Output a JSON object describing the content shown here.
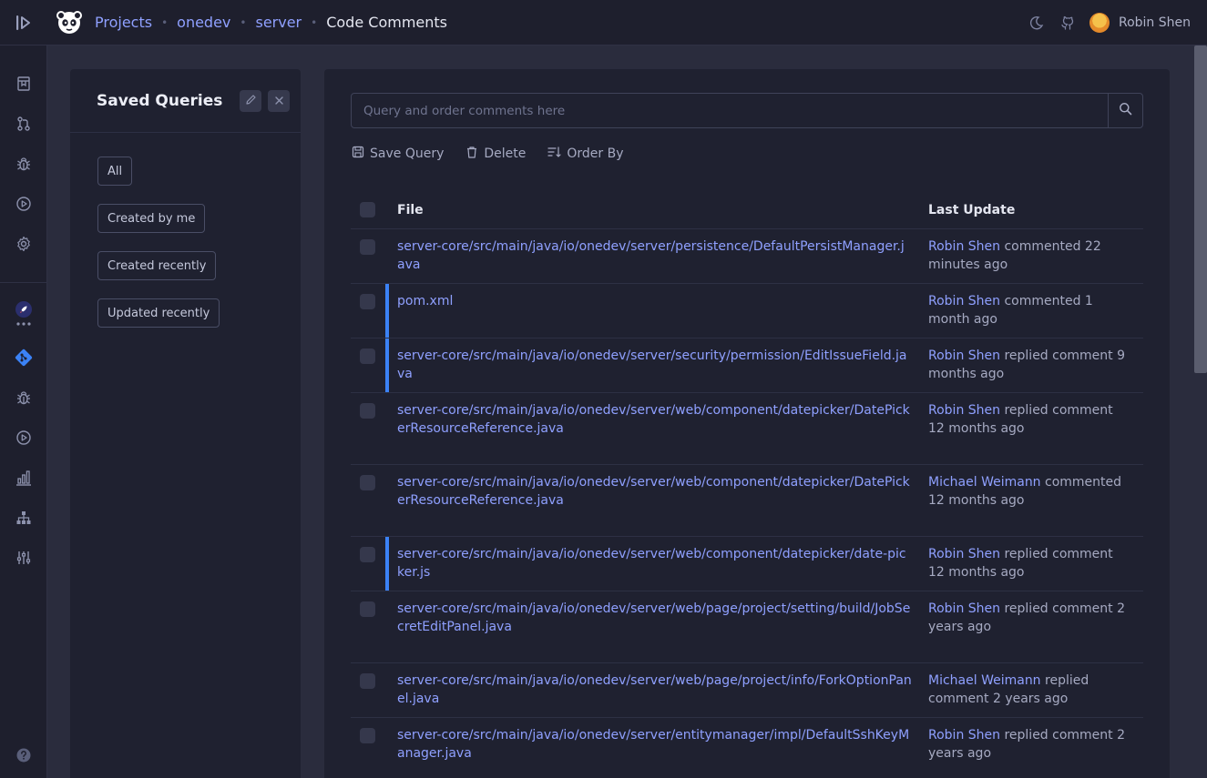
{
  "header": {
    "breadcrumbs": [
      "Projects",
      "onedev",
      "server"
    ],
    "title": "Code Comments",
    "user_name": "Robin Shen"
  },
  "saved_queries": {
    "title": "Saved Queries",
    "items": [
      "All",
      "Created by me",
      "Created recently",
      "Updated recently"
    ]
  },
  "search": {
    "placeholder": "Query and order comments here"
  },
  "toolbar": {
    "save_label": "Save Query",
    "delete_label": "Delete",
    "order_label": "Order By"
  },
  "table": {
    "columns": [
      "File",
      "Last Update"
    ],
    "rows": [
      {
        "file": "server-core/src/main/java/io/onedev/server/persistence/DefaultPersistManager.java",
        "user": "Robin Shen",
        "action": " commented 22 minutes ago",
        "unread": false
      },
      {
        "file": "pom.xml",
        "user": "Robin Shen",
        "action": " commented 1 month ago",
        "unread": true
      },
      {
        "file": "server-core/src/main/java/io/onedev/server/security/permission/EditIssueField.java",
        "user": "Robin Shen",
        "action": " replied comment 9 months ago",
        "unread": true
      },
      {
        "file": "server-core/src/main/java/io/onedev/server/web/component/datepicker/DatePickerResourceReference.java",
        "user": "Robin Shen",
        "action": " replied comment 12 months ago",
        "unread": false
      },
      {
        "file": "server-core/src/main/java/io/onedev/server/web/component/datepicker/DatePickerResourceReference.java",
        "user": "Michael Weimann",
        "action": " commented 12 months ago",
        "unread": false
      },
      {
        "file": "server-core/src/main/java/io/onedev/server/web/component/datepicker/date-picker.js",
        "user": "Robin Shen",
        "action": " replied comment 12 months ago",
        "unread": true
      },
      {
        "file": "server-core/src/main/java/io/onedev/server/web/page/project/setting/build/JobSecretEditPanel.java",
        "user": "Robin Shen",
        "action": " replied comment 2 years ago",
        "unread": false
      },
      {
        "file": "server-core/src/main/java/io/onedev/server/web/page/project/info/ForkOptionPanel.java",
        "user": "Michael Weimann",
        "action": " replied comment 2 years ago",
        "unread": false
      },
      {
        "file": "server-core/src/main/java/io/onedev/server/entitymanager/impl/DefaultSshKeyManager.java",
        "user": "Robin Shen",
        "action": " replied comment 2 years ago",
        "unread": false
      }
    ]
  },
  "icons": {
    "sidebar": [
      "bookmark-icon",
      "pull-request-icon",
      "bug-icon",
      "play-icon",
      "gear-icon",
      "rocket-icon",
      "more-icon",
      "git-icon",
      "bug-icon",
      "play-icon",
      "chart-icon",
      "hierarchy-icon",
      "sliders-icon",
      "help-icon"
    ],
    "accent": "#8fa0ff",
    "unread_bar": "#3b82f6"
  }
}
